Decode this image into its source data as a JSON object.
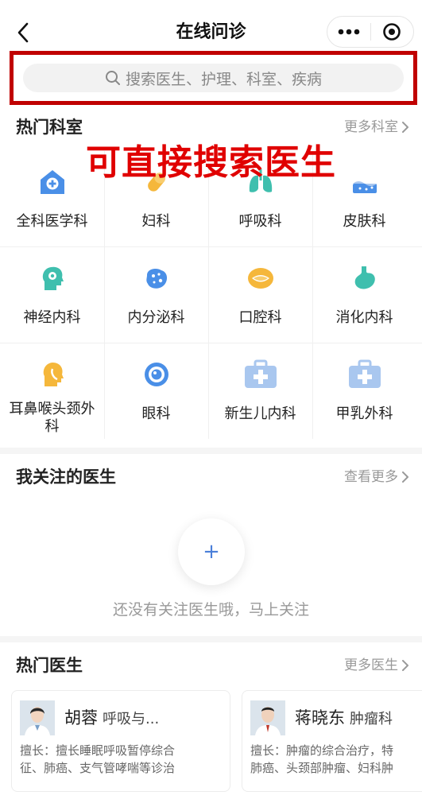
{
  "nav": {
    "title": "在线问诊"
  },
  "search": {
    "placeholder": "搜索医生、护理、科室、疾病"
  },
  "annotation": {
    "caption": "可直接搜索医生"
  },
  "departments": {
    "title": "热门科室",
    "more": "更多科室",
    "items": [
      {
        "label": "全科医学科",
        "icon": "house-plus-icon",
        "color": "#4a8fe7"
      },
      {
        "label": "妇科",
        "icon": "pill-icon",
        "color": "#f5b73b"
      },
      {
        "label": "呼吸科",
        "icon": "lungs-icon",
        "color": "#3fbfae"
      },
      {
        "label": "皮肤科",
        "icon": "skin-icon",
        "color": "#4a8fe7"
      },
      {
        "label": "神经内科",
        "icon": "brain-head-icon",
        "color": "#3fbfae"
      },
      {
        "label": "内分泌科",
        "icon": "cell-icon",
        "color": "#4a8fe7"
      },
      {
        "label": "口腔科",
        "icon": "mouth-icon",
        "color": "#f5b73b"
      },
      {
        "label": "消化内科",
        "icon": "stomach-icon",
        "color": "#3fbfae"
      },
      {
        "label": "耳鼻喉头颈外科",
        "icon": "ent-head-icon",
        "color": "#f5b73b"
      },
      {
        "label": "眼科",
        "icon": "eye-icon",
        "color": "#4a8fe7"
      },
      {
        "label": "新生儿内科",
        "icon": "medkit-icon",
        "color": "#a9c7ef"
      },
      {
        "label": "甲乳外科",
        "icon": "medkit-icon",
        "color": "#a9c7ef"
      }
    ]
  },
  "followed": {
    "title": "我关注的医生",
    "more": "查看更多",
    "empty_text": "还没有关注医生哦，马上关注",
    "add_symbol": "+"
  },
  "hot_doctors": {
    "title": "热门医生",
    "more": "更多医生",
    "items": [
      {
        "name": "胡蓉",
        "dept": "呼吸与...",
        "skill_line1": "擅长：擅长睡眠呼吸暂停综合",
        "skill_line2": "征、肺癌、支气管哮喘等诊治"
      },
      {
        "name": "蒋晓东",
        "dept": "肿瘤科",
        "skill_line1": "擅长：肿瘤的综合治疗，特",
        "skill_line2": "肺癌、头颈部肿瘤、妇科肿"
      }
    ]
  }
}
